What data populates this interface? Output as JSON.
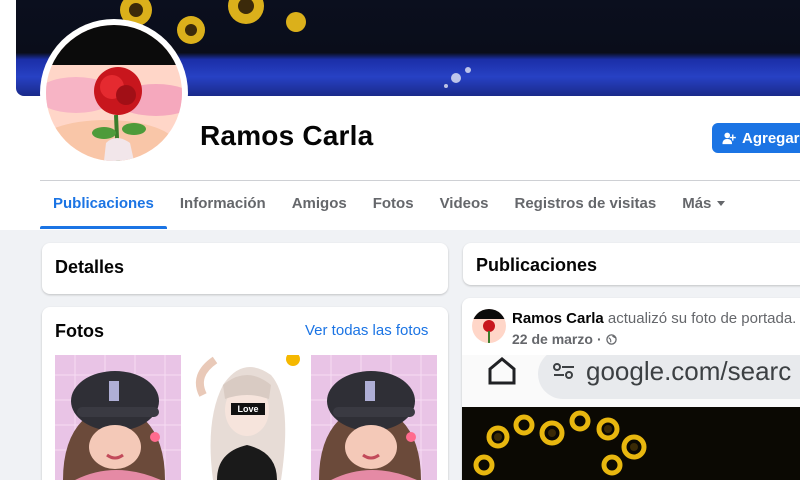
{
  "profile": {
    "name": "Ramos Carla",
    "add_button_label": "Agregar"
  },
  "tabs": [
    {
      "label": "Publicaciones",
      "active": true
    },
    {
      "label": "Información"
    },
    {
      "label": "Amigos"
    },
    {
      "label": "Fotos"
    },
    {
      "label": "Videos"
    },
    {
      "label": "Registros de visitas"
    },
    {
      "label": "Más"
    }
  ],
  "details_card": {
    "title": "Detalles"
  },
  "photos_card": {
    "title": "Fotos",
    "see_all_label": "Ver todas las fotos",
    "photos": [
      {
        "icon": "bts-cap-girl-photo"
      },
      {
        "icon": "love-girl-photo",
        "caption": "Love"
      },
      {
        "icon": "bts-cap-girl-photo"
      }
    ]
  },
  "posts_card": {
    "title": "Publicaciones"
  },
  "post": {
    "author": "Ramos Carla",
    "action": "actualizó su foto de portada.",
    "date": "22 de marzo",
    "separator": "·",
    "image_url_text": "google.com/searc"
  },
  "colors": {
    "accent": "#1b74e4",
    "secondary_text": "#65676b",
    "background": "#f0f2f5"
  }
}
